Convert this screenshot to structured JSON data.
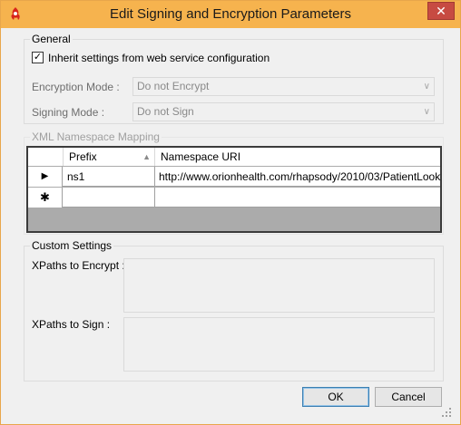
{
  "window": {
    "title": "Edit Signing and Encryption Parameters",
    "close_glyph": "✕",
    "app_icon": "rhapsody-flame-icon",
    "accent_color": "#f6b34e"
  },
  "general": {
    "label": "General",
    "inherit": {
      "label": "Inherit settings from web service configuration",
      "checked": true
    },
    "encryption_mode": {
      "label": "Encryption Mode :",
      "value": "Do not Encrypt"
    },
    "signing_mode": {
      "label": "Signing Mode :",
      "value": "Do not Sign"
    }
  },
  "namespace": {
    "label": "XML Namespace Mapping",
    "columns": [
      "Prefix",
      "Namespace URI"
    ],
    "rows": [
      {
        "prefix": "ns1",
        "uri": "http://www.orionhealth.com/rhapsody/2010/03/PatientLooku..."
      }
    ],
    "new_row_glyph": "✱",
    "current_row_glyph": "▶"
  },
  "custom": {
    "label": "Custom Settings",
    "xpaths_encrypt": {
      "label": "XPaths to Encrypt :",
      "value": ""
    },
    "xpaths_sign": {
      "label": "XPaths to Sign :",
      "value": ""
    }
  },
  "buttons": {
    "ok": "OK",
    "cancel": "Cancel"
  }
}
